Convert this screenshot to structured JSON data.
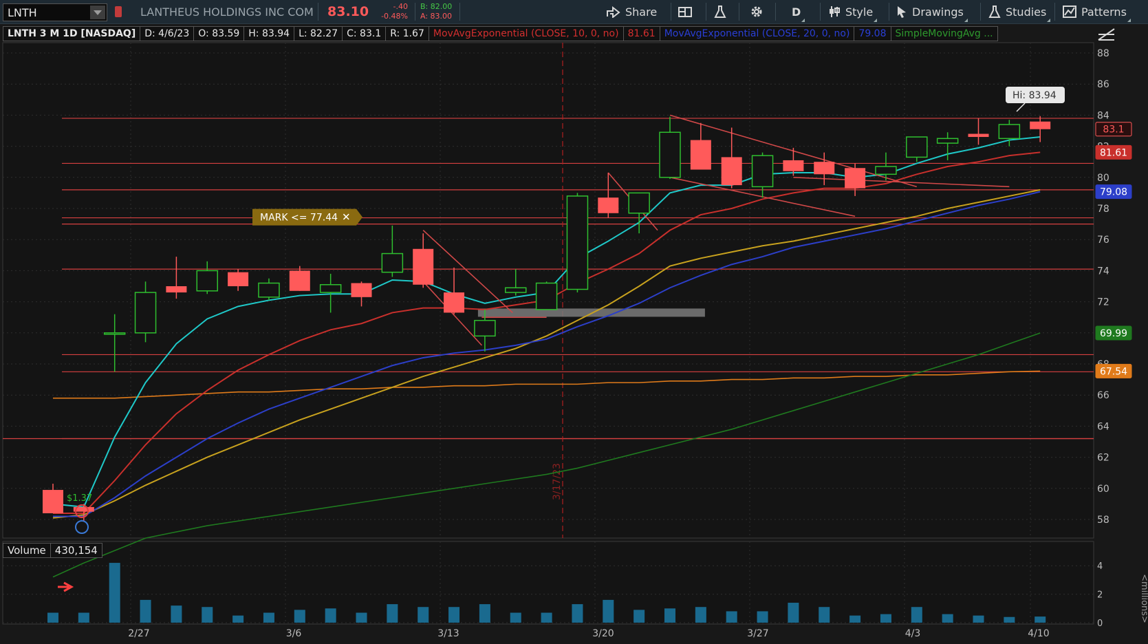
{
  "toolbar": {
    "symbol": "LNTH",
    "company": "LANTHEUS HOLDINGS INC COM",
    "last": "83.10",
    "change": "-.40",
    "change_pct": "-0.48%",
    "bid": "B: 82.00",
    "ask": "A: 83.00",
    "share_label": "Share",
    "timeframe_label": "D",
    "style_label": "Style",
    "drawings_label": "Drawings",
    "studies_label": "Studies",
    "patterns_label": "Patterns"
  },
  "infobar": {
    "title": "LNTH 3 M 1D [NASDAQ]",
    "date": "D: 4/6/23",
    "open": "O: 83.59",
    "high": "H: 83.94",
    "low": "L: 82.27",
    "close": "C: 83.1",
    "range": "R: 1.67",
    "ema10_label": "MovAvgExponential (CLOSE, 10, 0, no)",
    "ema10_value": "81.61",
    "ema20_label": "MovAvgExponential (CLOSE, 20, 0, no)",
    "ema20_value": "79.08",
    "sma_label": "SimpleMovingAvg ..."
  },
  "colors": {
    "up": "#2fbf2f",
    "down": "#ff5a5a",
    "ema10": "#c9302c",
    "ema20": "#2c3fc9",
    "ema_fast": "#1fc9c9",
    "sma_gold": "#c8a21e",
    "sma_green": "#1f7a1f",
    "sma_orange": "#e07b1a",
    "volume": "#1a6a8f"
  },
  "chart_data": {
    "type": "candlestick",
    "price_axis": {
      "ticks": [
        "88",
        "86",
        "84",
        "82",
        "80",
        "78",
        "76",
        "74",
        "72",
        "70",
        "68",
        "66",
        "64",
        "62",
        "60",
        "58"
      ]
    },
    "date_axis": {
      "ticks": [
        "2/27",
        "3/6",
        "3/13",
        "3/20",
        "3/27",
        "4/3",
        "4/10"
      ]
    },
    "candles": [
      {
        "o": 59.9,
        "h": 60.3,
        "l": 58.4,
        "c": 58.4
      },
      {
        "o": 58.8,
        "h": 59.0,
        "l": 57.9,
        "c": 58.5
      },
      {
        "o": 70.0,
        "h": 71.2,
        "l": 67.5,
        "c": 70.0
      },
      {
        "o": 70.0,
        "h": 73.3,
        "l": 69.4,
        "c": 72.6
      },
      {
        "o": 73.0,
        "h": 74.9,
        "l": 72.2,
        "c": 72.6
      },
      {
        "o": 72.7,
        "h": 74.6,
        "l": 72.5,
        "c": 74.0
      },
      {
        "o": 73.9,
        "h": 74.1,
        "l": 72.7,
        "c": 73.0
      },
      {
        "o": 72.3,
        "h": 73.5,
        "l": 72.1,
        "c": 73.2
      },
      {
        "o": 74.0,
        "h": 74.3,
        "l": 72.7,
        "c": 72.7
      },
      {
        "o": 72.6,
        "h": 73.8,
        "l": 71.3,
        "c": 73.1
      },
      {
        "o": 73.2,
        "h": 73.3,
        "l": 71.7,
        "c": 72.3
      },
      {
        "o": 73.9,
        "h": 76.9,
        "l": 73.6,
        "c": 75.1
      },
      {
        "o": 75.4,
        "h": 76.4,
        "l": 72.9,
        "c": 73.1
      },
      {
        "o": 72.6,
        "h": 74.2,
        "l": 71.2,
        "c": 71.3
      },
      {
        "o": 69.8,
        "h": 71.5,
        "l": 68.8,
        "c": 70.8
      },
      {
        "o": 72.6,
        "h": 74.1,
        "l": 72.4,
        "c": 72.9
      },
      {
        "o": 71.5,
        "h": 73.3,
        "l": 71.5,
        "c": 73.2
      },
      {
        "o": 72.8,
        "h": 79.0,
        "l": 72.6,
        "c": 78.8
      },
      {
        "o": 78.7,
        "h": 80.3,
        "l": 77.4,
        "c": 77.7
      },
      {
        "o": 77.7,
        "h": 79.0,
        "l": 76.4,
        "c": 79.0
      },
      {
        "o": 80.0,
        "h": 83.9,
        "l": 79.9,
        "c": 82.9
      },
      {
        "o": 82.4,
        "h": 83.5,
        "l": 80.5,
        "c": 80.5
      },
      {
        "o": 81.3,
        "h": 83.2,
        "l": 79.3,
        "c": 79.5
      },
      {
        "o": 79.4,
        "h": 81.6,
        "l": 78.7,
        "c": 81.4
      },
      {
        "o": 81.1,
        "h": 81.9,
        "l": 80.1,
        "c": 80.4
      },
      {
        "o": 81.0,
        "h": 81.6,
        "l": 79.5,
        "c": 80.2
      },
      {
        "o": 80.6,
        "h": 80.9,
        "l": 78.8,
        "c": 79.3
      },
      {
        "o": 80.2,
        "h": 81.6,
        "l": 79.8,
        "c": 80.7
      },
      {
        "o": 81.3,
        "h": 82.6,
        "l": 81.0,
        "c": 82.6
      },
      {
        "o": 82.2,
        "h": 82.9,
        "l": 81.1,
        "c": 82.5
      },
      {
        "o": 82.8,
        "h": 83.8,
        "l": 82.1,
        "c": 82.6
      },
      {
        "o": 82.5,
        "h": 83.7,
        "l": 82.0,
        "c": 83.4
      },
      {
        "o": 83.59,
        "h": 83.94,
        "l": 82.27,
        "c": 83.1
      }
    ],
    "ema_fast": [
      59.0,
      58.8,
      63.3,
      66.8,
      69.3,
      70.9,
      71.7,
      72.1,
      72.4,
      72.5,
      72.5,
      73.4,
      73.3,
      72.5,
      71.9,
      72.3,
      72.6,
      74.8,
      75.9,
      77.1,
      79.0,
      79.5,
      79.5,
      80.2,
      80.3,
      80.3,
      80.0,
      80.2,
      80.9,
      81.5,
      81.9,
      82.4,
      82.6
    ],
    "ema10": [
      58.4,
      58.4,
      60.5,
      62.8,
      64.8,
      66.3,
      67.6,
      68.6,
      69.5,
      70.2,
      70.6,
      71.3,
      71.6,
      71.6,
      71.5,
      71.8,
      72.1,
      73.2,
      74.1,
      75.1,
      76.6,
      77.6,
      78.0,
      78.6,
      79.0,
      79.3,
      79.3,
      79.6,
      80.2,
      80.7,
      81.0,
      81.4,
      81.61
    ],
    "ema20": [
      58.2,
      58.2,
      59.4,
      60.8,
      62.0,
      63.2,
      64.2,
      65.1,
      65.8,
      66.5,
      67.2,
      67.9,
      68.4,
      68.7,
      68.9,
      69.2,
      69.6,
      70.4,
      71.1,
      71.9,
      72.9,
      73.7,
      74.4,
      74.9,
      75.5,
      75.9,
      76.3,
      76.7,
      77.2,
      77.7,
      78.2,
      78.6,
      79.08
    ],
    "sma_gold": [
      58.1,
      58.3,
      59.2,
      60.2,
      61.1,
      62.0,
      62.8,
      63.6,
      64.4,
      65.1,
      65.8,
      66.5,
      67.2,
      67.8,
      68.4,
      69.0,
      69.8,
      70.8,
      71.8,
      73.0,
      74.3,
      74.8,
      75.2,
      75.6,
      75.9,
      76.3,
      76.7,
      77.1,
      77.5,
      78.0,
      78.4,
      78.8,
      79.2
    ],
    "sma_green": [
      54.3,
      55.2,
      56.0,
      56.8,
      57.2,
      57.6,
      57.9,
      58.2,
      58.5,
      58.8,
      59.1,
      59.4,
      59.7,
      60.0,
      60.3,
      60.6,
      60.9,
      61.3,
      61.8,
      62.3,
      62.8,
      63.3,
      63.8,
      64.4,
      65.0,
      65.6,
      66.2,
      66.8,
      67.4,
      68.0,
      68.6,
      69.3,
      69.99
    ],
    "sma_orange": [
      65.8,
      65.8,
      65.8,
      65.9,
      66.0,
      66.1,
      66.2,
      66.2,
      66.3,
      66.4,
      66.4,
      66.5,
      66.5,
      66.6,
      66.6,
      66.7,
      66.7,
      66.7,
      66.8,
      66.8,
      66.9,
      66.9,
      67.0,
      67.0,
      67.1,
      67.1,
      67.2,
      67.2,
      67.3,
      67.3,
      67.4,
      67.5,
      67.54
    ],
    "volume_millions": [
      0.7,
      0.7,
      4.2,
      1.6,
      1.2,
      1.1,
      0.5,
      0.7,
      0.9,
      1.0,
      0.7,
      1.3,
      1.1,
      1.1,
      1.3,
      0.7,
      0.7,
      1.3,
      1.6,
      0.9,
      1.0,
      1.1,
      0.8,
      0.8,
      1.4,
      1.1,
      0.5,
      0.6,
      1.1,
      0.6,
      0.5,
      0.4,
      0.43
    ],
    "volume_axis": {
      "ticks": [
        "4",
        "2",
        "0"
      ],
      "unit": "<millions>"
    },
    "volume_label": "Volume",
    "volume_value": "430,154",
    "price_badges": [
      {
        "text": "83.1",
        "value": 83.1,
        "color": "#ff5a5a",
        "fg": "#ff5a5a",
        "bg": "#2a0f0f"
      },
      {
        "text": "81.61",
        "value": 81.61,
        "color": "#c9302c",
        "fg": "#ffffff",
        "bg": "#c9302c"
      },
      {
        "text": "79.08",
        "value": 79.08,
        "color": "#2c3fc9",
        "fg": "#ffffff",
        "bg": "#2c3fc9"
      },
      {
        "text": "69.99",
        "value": 69.99,
        "color": "#1f7a1f",
        "fg": "#ffffff",
        "bg": "#1f7a1f"
      },
      {
        "text": "67.54",
        "value": 67.54,
        "color": "#e07b1a",
        "fg": "#ffffff",
        "bg": "#e07b1a"
      }
    ],
    "hi_label": "Hi: 83.94",
    "mark_label": "MARK <= 77.44",
    "mark_value": 77.44,
    "event_date_label": "3/17/23",
    "dividend_label": "$1.37",
    "hlines": [
      83.8,
      80.9,
      79.2,
      77.4,
      77.0,
      74.1,
      68.6,
      67.5,
      63.2
    ],
    "trendlines": [
      {
        "from": [
          20,
          84.0
        ],
        "to": [
          28,
          79.4
        ]
      },
      {
        "from": [
          20,
          80.0
        ],
        "to": [
          26,
          77.5
        ]
      },
      {
        "from": [
          24,
          80.0
        ],
        "to": [
          31,
          79.4
        ]
      },
      {
        "from": [
          18,
          80.3
        ],
        "to": [
          19.6,
          76.6
        ]
      },
      {
        "from": [
          12,
          76.6
        ],
        "to": [
          14.9,
          71.3
        ]
      },
      {
        "from": [
          12,
          73.3
        ],
        "to": [
          13.9,
          69.2
        ]
      },
      {
        "from": [
          13.9,
          71.0
        ],
        "to": [
          16.0,
          71.0
        ]
      }
    ]
  }
}
